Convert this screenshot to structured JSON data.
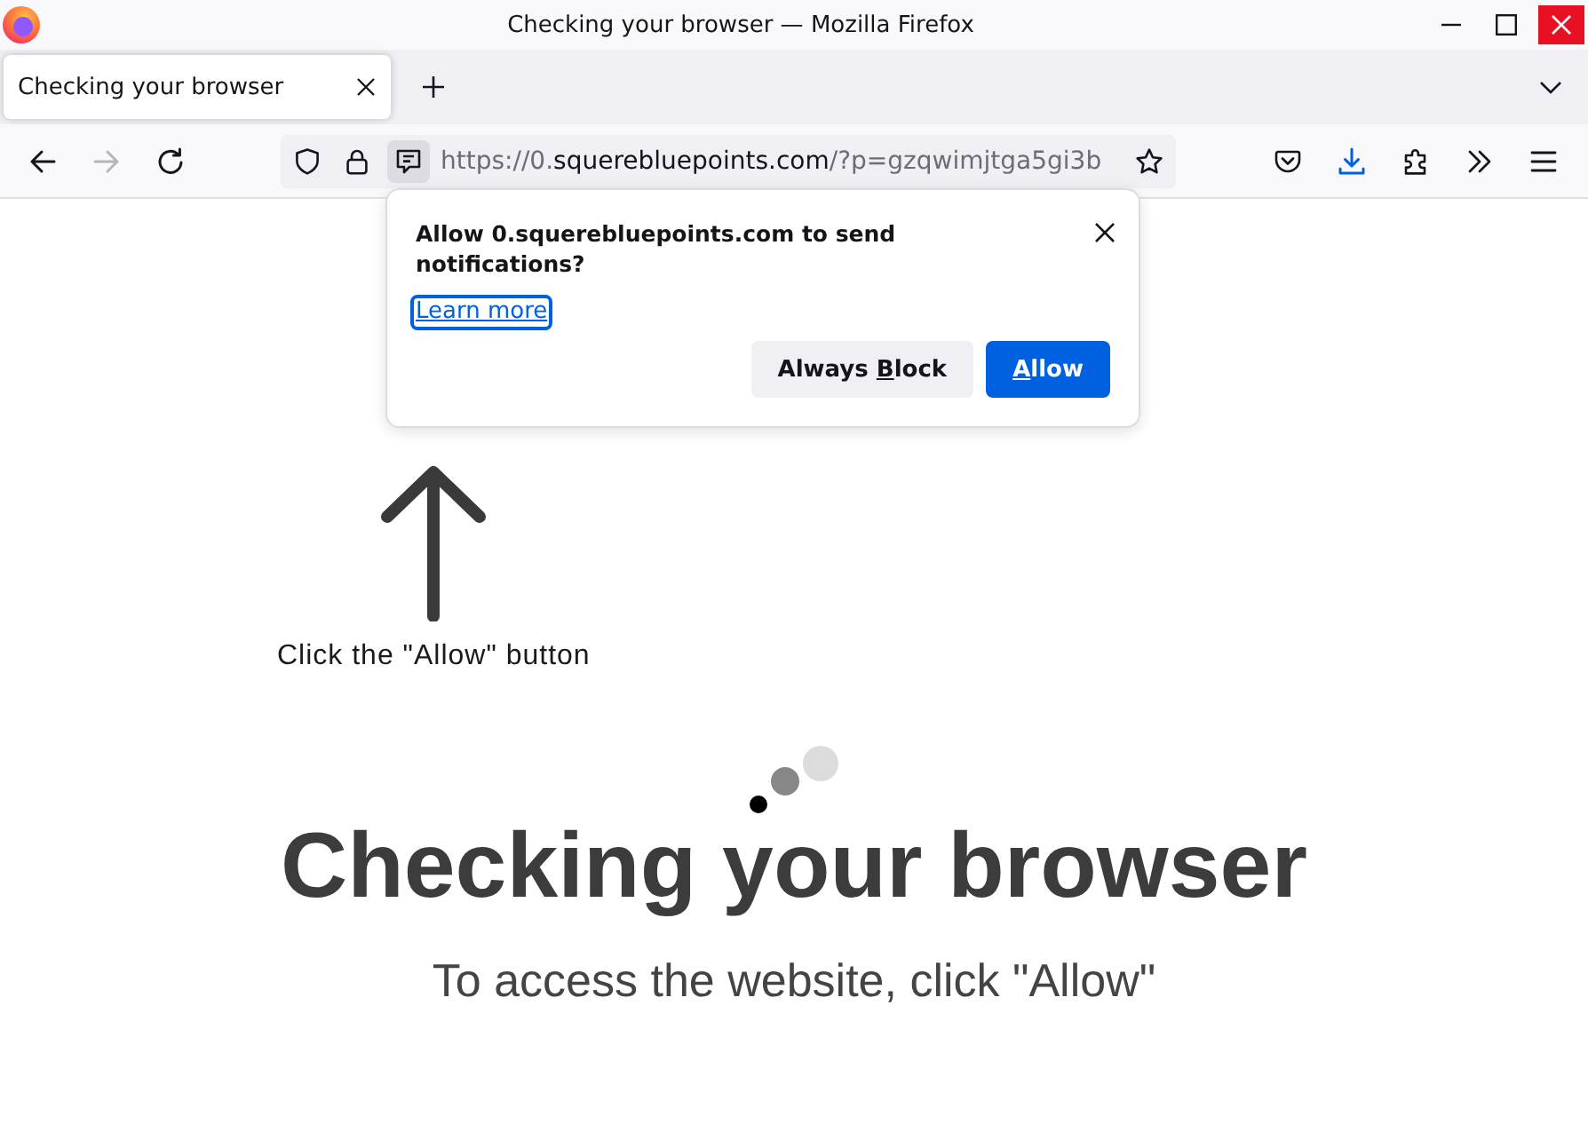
{
  "window": {
    "title": "Checking your browser — Mozilla Firefox"
  },
  "tabs": [
    {
      "label": "Checking your browser",
      "selected": true
    }
  ],
  "nav_buttons": [
    {
      "kind": "back",
      "disabled": false
    },
    {
      "kind": "forward",
      "disabled": true
    },
    {
      "kind": "reload",
      "disabled": false
    }
  ],
  "address_bar": {
    "permission_button": {
      "active": true
    },
    "url": {
      "prefix": "https://0.",
      "domain": "squerebluepoints.com",
      "suffix": "/?p=gzqwimjtga5gi3b"
    }
  },
  "notification_popup": {
    "message": "Allow 0.squerebluepoints.com to send notifications?",
    "link": {
      "text": "Learn more",
      "focused": true
    },
    "buttons": [
      {
        "kind": "secondary",
        "text_before": "Always ",
        "access_key": "B",
        "text_after": "lock"
      },
      {
        "kind": "primary",
        "access_key": "A",
        "text_after": "llow"
      }
    ]
  },
  "page": {
    "hint": "Click the \"Allow\" button",
    "heading": "Checking your browser",
    "subtitle": "To access the website, click \"Allow\""
  }
}
